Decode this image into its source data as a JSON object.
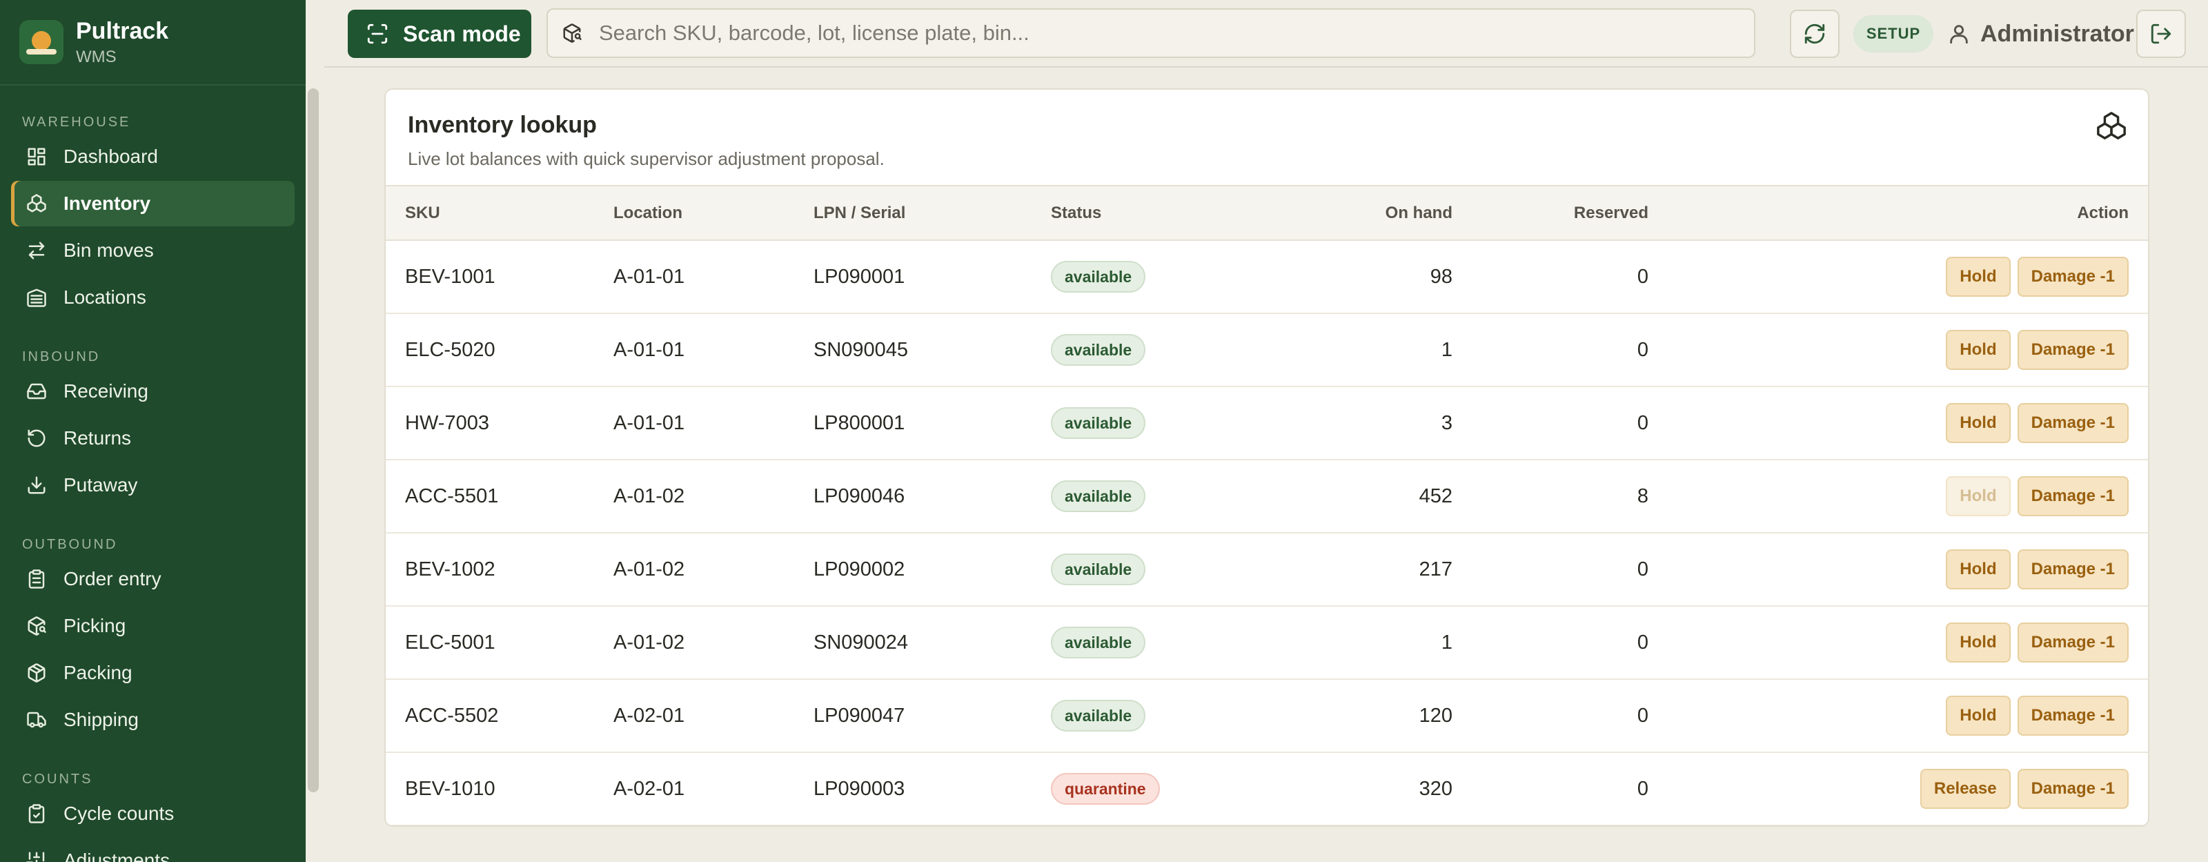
{
  "brand": {
    "name": "Pultrack",
    "sub": "WMS"
  },
  "sidebar": {
    "sections": [
      {
        "label": "WAREHOUSE",
        "items": [
          {
            "label": "Dashboard",
            "icon": "dashboard-icon",
            "active": false
          },
          {
            "label": "Inventory",
            "icon": "boxes-icon",
            "active": true
          },
          {
            "label": "Bin moves",
            "icon": "arrows-swap-icon",
            "active": false
          },
          {
            "label": "Locations",
            "icon": "warehouse-icon",
            "active": false
          }
        ]
      },
      {
        "label": "INBOUND",
        "items": [
          {
            "label": "Receiving",
            "icon": "inbox-icon",
            "active": false
          },
          {
            "label": "Returns",
            "icon": "rotate-ccw-icon",
            "active": false
          },
          {
            "label": "Putaway",
            "icon": "download-icon",
            "active": false
          }
        ]
      },
      {
        "label": "OUTBOUND",
        "items": [
          {
            "label": "Order entry",
            "icon": "clipboard-icon",
            "active": false
          },
          {
            "label": "Picking",
            "icon": "package-search-icon",
            "active": false
          },
          {
            "label": "Packing",
            "icon": "package-icon",
            "active": false
          },
          {
            "label": "Shipping",
            "icon": "truck-icon",
            "active": false
          }
        ]
      },
      {
        "label": "COUNTS",
        "items": [
          {
            "label": "Cycle counts",
            "icon": "clipboard-check-icon",
            "active": false
          },
          {
            "label": "Adjustments",
            "icon": "sliders-icon",
            "active": false
          }
        ]
      }
    ]
  },
  "topbar": {
    "scan_label": "Scan mode",
    "search_placeholder": "Search SKU, barcode, lot, license plate, bin...",
    "badge": "SETUP",
    "user": "Administrator"
  },
  "card": {
    "title": "Inventory lookup",
    "subtitle": "Live lot balances with quick supervisor adjustment proposal.",
    "columns": [
      "SKU",
      "Location",
      "LPN / Serial",
      "Status",
      "On hand",
      "Reserved",
      "Action"
    ],
    "rows": [
      {
        "sku": "BEV-1001",
        "location": "A-01-01",
        "lpn": "LP090001",
        "status": "available",
        "on_hand": "98",
        "reserved": "0",
        "primary": "Hold",
        "primary_disabled": false,
        "secondary": "Damage -1"
      },
      {
        "sku": "ELC-5020",
        "location": "A-01-01",
        "lpn": "SN090045",
        "status": "available",
        "on_hand": "1",
        "reserved": "0",
        "primary": "Hold",
        "primary_disabled": false,
        "secondary": "Damage -1"
      },
      {
        "sku": "HW-7003",
        "location": "A-01-01",
        "lpn": "LP800001",
        "status": "available",
        "on_hand": "3",
        "reserved": "0",
        "primary": "Hold",
        "primary_disabled": false,
        "secondary": "Damage -1"
      },
      {
        "sku": "ACC-5501",
        "location": "A-01-02",
        "lpn": "LP090046",
        "status": "available",
        "on_hand": "452",
        "reserved": "8",
        "primary": "Hold",
        "primary_disabled": true,
        "secondary": "Damage -1"
      },
      {
        "sku": "BEV-1002",
        "location": "A-01-02",
        "lpn": "LP090002",
        "status": "available",
        "on_hand": "217",
        "reserved": "0",
        "primary": "Hold",
        "primary_disabled": false,
        "secondary": "Damage -1"
      },
      {
        "sku": "ELC-5001",
        "location": "A-01-02",
        "lpn": "SN090024",
        "status": "available",
        "on_hand": "1",
        "reserved": "0",
        "primary": "Hold",
        "primary_disabled": false,
        "secondary": "Damage -1"
      },
      {
        "sku": "ACC-5502",
        "location": "A-02-01",
        "lpn": "LP090047",
        "status": "available",
        "on_hand": "120",
        "reserved": "0",
        "primary": "Hold",
        "primary_disabled": false,
        "secondary": "Damage -1"
      },
      {
        "sku": "BEV-1010",
        "location": "A-02-01",
        "lpn": "LP090003",
        "status": "quarantine",
        "on_hand": "320",
        "reserved": "0",
        "primary": "Release",
        "primary_disabled": false,
        "secondary": "Damage -1"
      }
    ]
  }
}
